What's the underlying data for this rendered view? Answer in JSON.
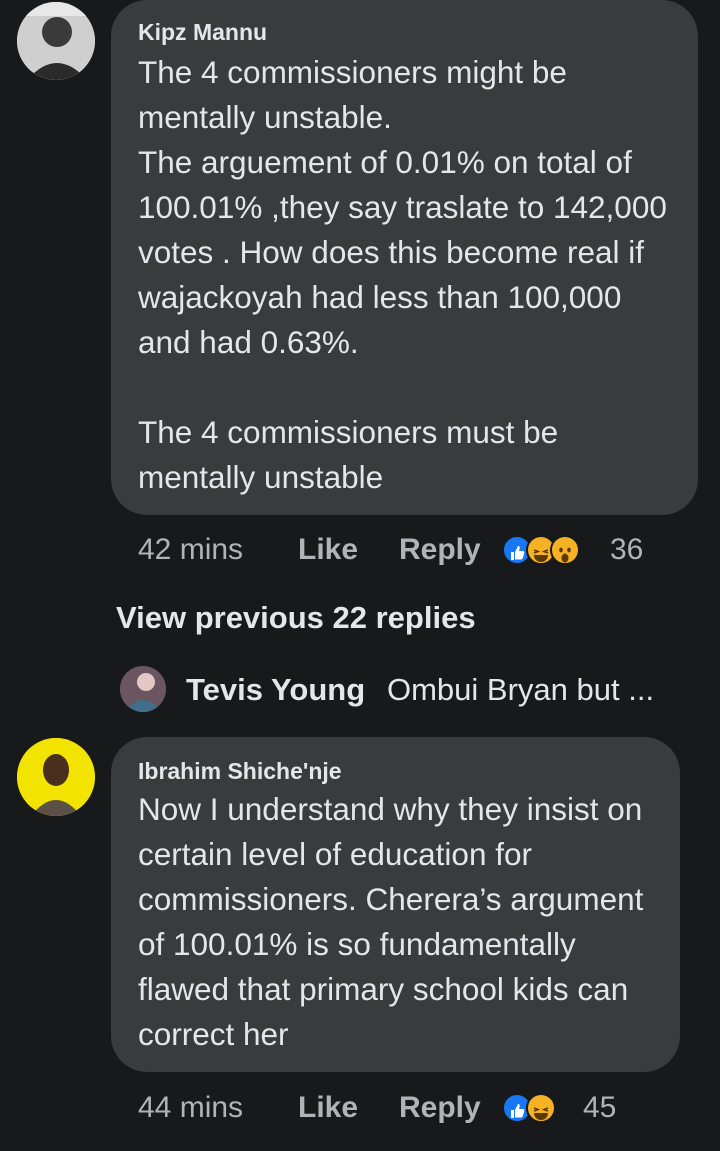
{
  "comment1": {
    "author": "Kipz Mannu",
    "body": "The 4 commissioners might be mentally unstable.\nThe arguement of 0.01% on total of 100.01% ,they say traslate to 142,000 votes . How does this become real if wajackoyah had less than 100,000 and had 0.63%.\n\nThe 4 commissioners must be mentally unstable",
    "time": "42 mins",
    "like_label": "Like",
    "reply_label": "Reply",
    "reactions": [
      "like-icon",
      "haha-icon",
      "wow-icon"
    ],
    "reaction_count": "36"
  },
  "view_previous": "View previous 22 replies",
  "reply_preview": {
    "name": "Tevis Young",
    "text": "Ombui Bryan but ..."
  },
  "comment2": {
    "author": "Ibrahim Shiche'nje",
    "body": "Now I understand why they insist on certain level of education for commissioners. Cherera’s argument of 100.01% is so fundamentally flawed that primary school kids can correct her",
    "time": "44 mins",
    "like_label": "Like",
    "reply_label": "Reply",
    "reactions": [
      "like-icon",
      "haha-icon"
    ],
    "reaction_count": "45"
  },
  "colors": {
    "background": "#18191a",
    "bubble": "#3a3b3c",
    "text": "#e4e6eb",
    "secondary_text": "#b0b3b8",
    "like_blue": "#1877f2",
    "haha_yellow": "#f7b125"
  }
}
